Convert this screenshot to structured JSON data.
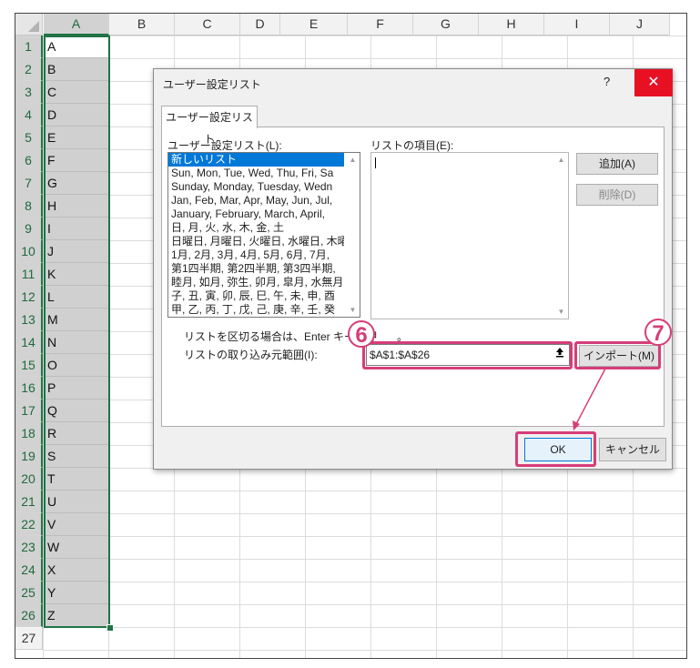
{
  "sheet": {
    "columns": [
      "A",
      "B",
      "C",
      "D",
      "E",
      "F",
      "G",
      "H",
      "I",
      "J"
    ],
    "rows": [
      "1",
      "2",
      "3",
      "4",
      "5",
      "6",
      "7",
      "8",
      "9",
      "10",
      "11",
      "12",
      "13",
      "14",
      "15",
      "16",
      "17",
      "18",
      "19",
      "20",
      "21",
      "22",
      "23",
      "24",
      "25",
      "26",
      "27"
    ],
    "column_a": [
      "A",
      "B",
      "C",
      "D",
      "E",
      "F",
      "G",
      "H",
      "I",
      "J",
      "K",
      "L",
      "M",
      "N",
      "O",
      "P",
      "Q",
      "R",
      "S",
      "T",
      "U",
      "V",
      "W",
      "X",
      "Y",
      "Z"
    ]
  },
  "dialog": {
    "title": "ユーザー設定リスト",
    "help": "?",
    "close": "✕",
    "tab": "ユーザー設定リスト",
    "lists_label": "ユーザー設定リスト(L):",
    "entries_label": "リストの項目(E):",
    "lists": [
      "新しいリスト",
      "Sun, Mon, Tue, Wed, Thu, Fri, Sa",
      "Sunday, Monday, Tuesday, Wedn",
      "Jan, Feb, Mar, Apr, May, Jun, Jul,",
      "January, February, March, April,",
      "日, 月, 火, 水, 木, 金, 土",
      "日曜日, 月曜日, 火曜日, 水曜日, 木曜",
      "1月, 2月, 3月, 4月, 5月, 6月, 7月,",
      "第1四半期, 第2四半期, 第3四半期,",
      "睦月, 如月, 弥生, 卯月, 皐月, 水無月",
      "子, 丑, 寅, 卯, 辰, 巳, 午, 未, 申, 酉",
      "甲, 乙, 丙, 丁, 戊, 己, 庚, 辛, 壬, 癸"
    ],
    "add_button": "追加(A)",
    "delete_button": "削除(D)",
    "separator_note": "リストを区切る場合は、Enter キーを押",
    "separator_note_tail": "。",
    "import_label": "リストの取り込み元範囲(I):",
    "import_range": "$A$1:$A$26",
    "collapse_icon": "collapse-arrow-icon",
    "import_button": "インポート(M)",
    "ok_button": "OK",
    "cancel_button": "キャンセル"
  },
  "annotations": {
    "step6": "6",
    "step7": "7",
    "color": "#d63d78"
  }
}
